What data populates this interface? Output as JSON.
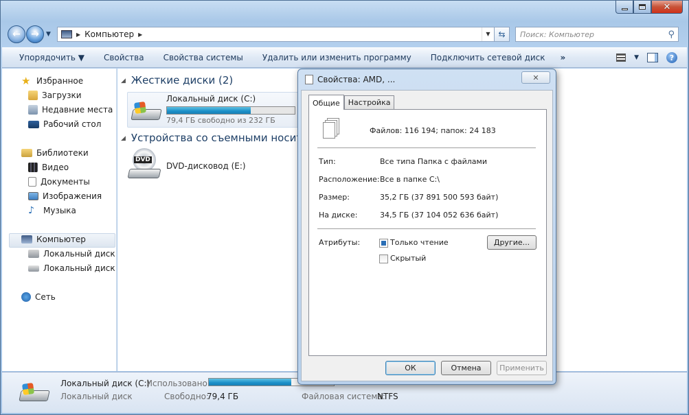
{
  "window": {
    "title_buttons": {
      "minimize": "—",
      "maximize": "□",
      "close": "✕"
    }
  },
  "nav": {
    "back": "←",
    "forward": "→",
    "address_location": "Компьютер",
    "address_sep": "▶",
    "address_dropdown": "▼",
    "refresh": "⇆",
    "search_placeholder": "Поиск: Компьютер",
    "search_icon": "⚲"
  },
  "toolbar": {
    "organize": "Упорядочить ▼",
    "properties": "Свойства",
    "system_properties": "Свойства системы",
    "uninstall": "Удалить или изменить программу",
    "map_drive": "Подключить сетевой диск",
    "more": "»",
    "view_dropdown": "▼",
    "help": "?"
  },
  "sidebar": {
    "favorites": "Избранное",
    "downloads": "Загрузки",
    "recent": "Недавние места",
    "desktop": "Рабочий стол",
    "libraries": "Библиотеки",
    "video": "Видео",
    "documents": "Документы",
    "pictures": "Изображения",
    "music": "Музыка",
    "computer": "Компьютер",
    "local_c": "Локальный диск (С",
    "local_d": "Локальный диск (D",
    "network": "Сеть"
  },
  "content": {
    "group_hdd": "Жесткие диски (2)",
    "group_removable": "Устройства со съемными носителя",
    "drive_c_name": "Локальный диск (C:)",
    "drive_c_free": "79,4 ГБ свободно из 232 ГБ",
    "drive_c_used_fraction": 0.658,
    "dvd_label": "DVD",
    "dvd_name": "DVD-дисковод (E:)"
  },
  "status": {
    "drive_name": "Локальный диск (C:)",
    "drive_type": "Локальный диск",
    "used_label": "Использовано:",
    "free_label": "Свободно:",
    "free_value": "79,4 ГБ",
    "fs_label": "Файловая система:",
    "fs_value": "NTFS",
    "used_fraction": 0.658
  },
  "dialog": {
    "title": "Свойства: AMD, ...",
    "close": "✕",
    "tab_general": "Общие",
    "tab_settings": "Настройка",
    "files_summary": "Файлов: 116 194; папок: 24 183",
    "type_label": "Тип:",
    "type_value": "Все типа Папка с файлами",
    "location_label": "Расположение:",
    "location_value": "Все в папке C:\\",
    "size_label": "Размер:",
    "size_value": "35,2 ГБ (37 891 500 593 байт)",
    "ondisk_label": "На диске:",
    "ondisk_value": "34,5 ГБ (37 104 052 636 байт)",
    "attributes_label": "Атрибуты:",
    "readonly_label": "Только чтение",
    "readonly_state": "indeterminate",
    "hidden_label": "Скрытый",
    "hidden_state": "unchecked",
    "other_button": "Другие...",
    "ok": "ОК",
    "cancel": "Отмена",
    "apply": "Применить"
  }
}
